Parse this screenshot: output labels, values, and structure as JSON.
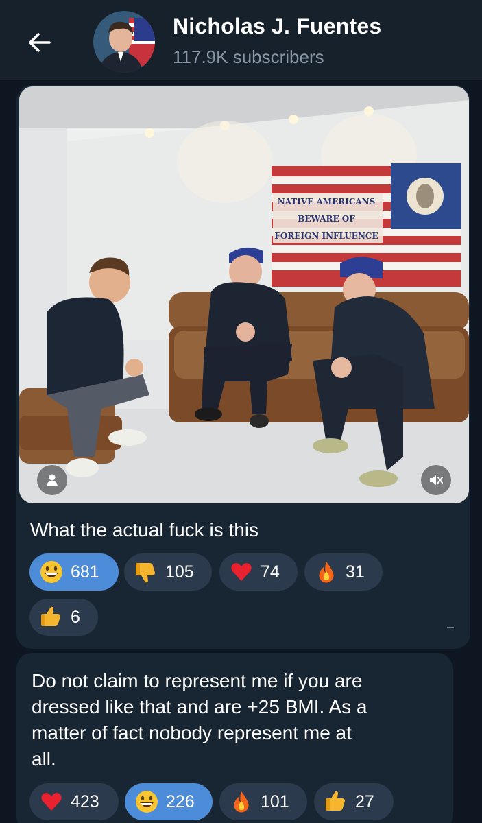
{
  "header": {
    "back_icon": "arrow-left-icon",
    "title": "Nicholas J. Fuentes",
    "subscribers": "117.9K subscribers"
  },
  "post1": {
    "photo_signs": {
      "flag_line1": "NATIVE AMERICANS",
      "flag_line2": "BEWARE OF",
      "flag_line3": "FOREIGN INFLUENCE"
    },
    "text": "What the actual fuck is this",
    "reactions": [
      {
        "emoji": "grinning-face",
        "count": "681",
        "chosen": true
      },
      {
        "emoji": "thumbs-down",
        "count": "105",
        "chosen": false
      },
      {
        "emoji": "red-heart",
        "count": "74",
        "chosen": false
      },
      {
        "emoji": "fire",
        "count": "31",
        "chosen": false
      },
      {
        "emoji": "thumbs-up",
        "count": "6",
        "chosen": false
      }
    ]
  },
  "post2": {
    "text_line1": "Do not claim to represent me if you are",
    "text_line2": "dressed like that and are +25 BMI. As a",
    "text_line3": "matter of fact nobody represent me at",
    "text_line4": "all.",
    "reactions": [
      {
        "emoji": "red-heart",
        "count": "423",
        "chosen": false
      },
      {
        "emoji": "grinning-face",
        "count": "226",
        "chosen": true
      },
      {
        "emoji": "fire",
        "count": "101",
        "chosen": false
      },
      {
        "emoji": "thumbs-up",
        "count": "27",
        "chosen": false
      }
    ]
  },
  "colors": {
    "header_bg": "#17212b",
    "bubble_bg": "#182533",
    "reaction_bg": "#2b3a4c",
    "reaction_chosen_bg": "#4c8cd8",
    "subtitle": "#8897a6"
  }
}
